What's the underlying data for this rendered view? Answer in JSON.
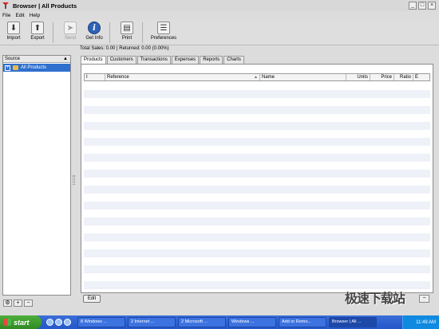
{
  "window": {
    "title": "Browser | All Products",
    "btn_min": "_",
    "btn_max": "□",
    "btn_close": "×"
  },
  "menu": [
    "File",
    "Edit",
    "Help"
  ],
  "toolbar": {
    "import": "Import",
    "export": "Export",
    "send": "Send",
    "get_info": "Get Info",
    "print": "Print",
    "preferences": "Preferences"
  },
  "status_text": "Total Sales: 0.00 | Returned: 0.00 (0.00%)",
  "source": {
    "header": "Source",
    "items": [
      {
        "label": "All Products",
        "expand": "+"
      }
    ]
  },
  "source_buttons": {
    "settings": "⚙",
    "add": "+",
    "remove": "−"
  },
  "tabs": [
    "Products",
    "Customers",
    "Transactions",
    "Expenses",
    "Reports",
    "Charts"
  ],
  "active_tab": "Products",
  "columns": [
    "I",
    "Reference",
    "Name",
    "Units",
    "Price",
    "Ratio",
    "E"
  ],
  "edit_label": "Edit",
  "watermark": "极速下载站",
  "taskbar": {
    "start": "start",
    "tasks": [
      "8 Windows ...",
      "2 Internet ...",
      "2 Microsoft ...",
      "Windows ...",
      "Add or Remo...",
      "Browser | All ..."
    ],
    "active_task": "Browser | All ...",
    "clock": "11:49 AM"
  },
  "colors": {
    "selection": "#2f6fce",
    "taskbar": "#2456c8",
    "start": "#2f8a23"
  }
}
